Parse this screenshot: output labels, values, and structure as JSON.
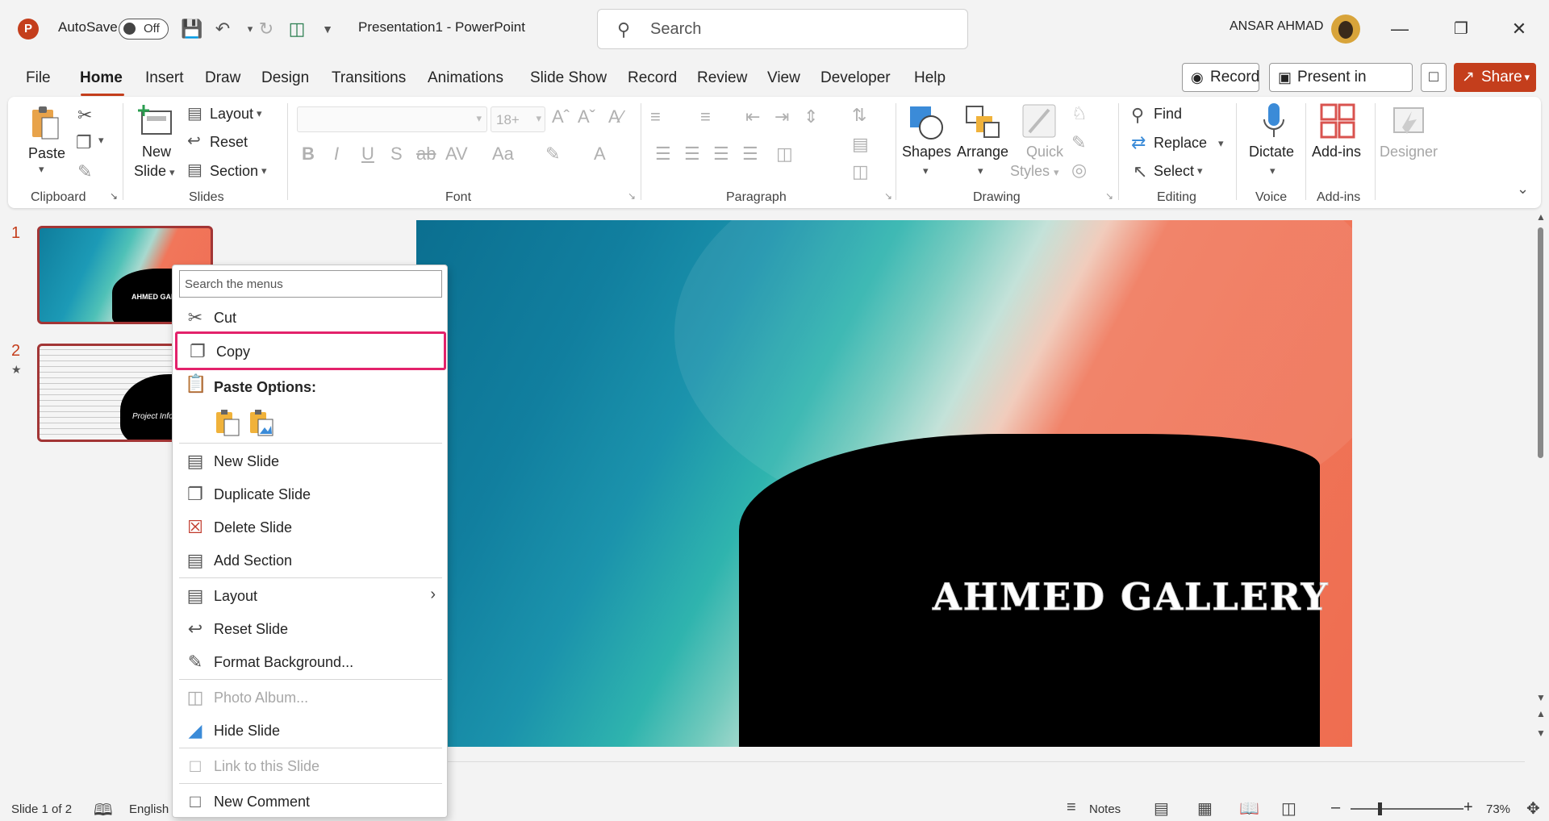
{
  "titlebar": {
    "app_logo": "P",
    "autosave_label": "AutoSave",
    "autosave_state": "Off",
    "doc_title": "Presentation1  -  PowerPoint",
    "search_placeholder": "Search",
    "user_name": "ANSAR AHMAD"
  },
  "menu_tabs": [
    "File",
    "Home",
    "Insert",
    "Draw",
    "Design",
    "Transitions",
    "Animations",
    "Slide Show",
    "Record",
    "Review",
    "View",
    "Developer",
    "Help"
  ],
  "header_buttons": {
    "record": "Record",
    "present_teams": "Present in Teams",
    "share": "Share"
  },
  "ribbon": {
    "clipboard": {
      "paste": "Paste",
      "group": "Clipboard"
    },
    "slides": {
      "new_slide_1": "New",
      "new_slide_2": "Slide",
      "layout": "Layout",
      "reset": "Reset",
      "section": "Section",
      "group": "Slides"
    },
    "font": {
      "size": "18+",
      "group": "Font"
    },
    "paragraph": {
      "group": "Paragraph"
    },
    "drawing": {
      "shapes": "Shapes",
      "arrange": "Arrange",
      "quick_1": "Quick",
      "quick_2": "Styles",
      "group": "Drawing"
    },
    "editing": {
      "find": "Find",
      "replace": "Replace",
      "select": "Select",
      "group": "Editing"
    },
    "voice": {
      "dictate": "Dictate",
      "group": "Voice"
    },
    "addins": {
      "addins": "Add-ins",
      "group": "Add-ins"
    },
    "designer": {
      "designer": "Designer"
    }
  },
  "slides_panel": {
    "slides": [
      {
        "number": "1",
        "thumb_text": "AHMED GAL"
      },
      {
        "number": "2",
        "thumb_text": "Project Info"
      }
    ]
  },
  "slide": {
    "title": "AHMED GALLERY"
  },
  "context_menu": {
    "search_placeholder": "Search the menus",
    "items": {
      "cut": "Cut",
      "copy": "Copy",
      "paste_options": "Paste Options:",
      "new_slide": "New Slide",
      "duplicate_slide": "Duplicate Slide",
      "delete_slide": "Delete Slide",
      "add_section": "Add Section",
      "layout": "Layout",
      "reset_slide": "Reset Slide",
      "format_background": "Format Background...",
      "photo_album": "Photo Album...",
      "hide_slide": "Hide Slide",
      "link_to_slide": "Link to this Slide",
      "new_comment": "New Comment"
    }
  },
  "statusbar": {
    "slide_count": "Slide 1 of 2",
    "language": "English",
    "notes": "Notes",
    "zoom": "73%"
  },
  "colors": {
    "accent": "#c43e1c",
    "highlight": "#e3226b"
  }
}
